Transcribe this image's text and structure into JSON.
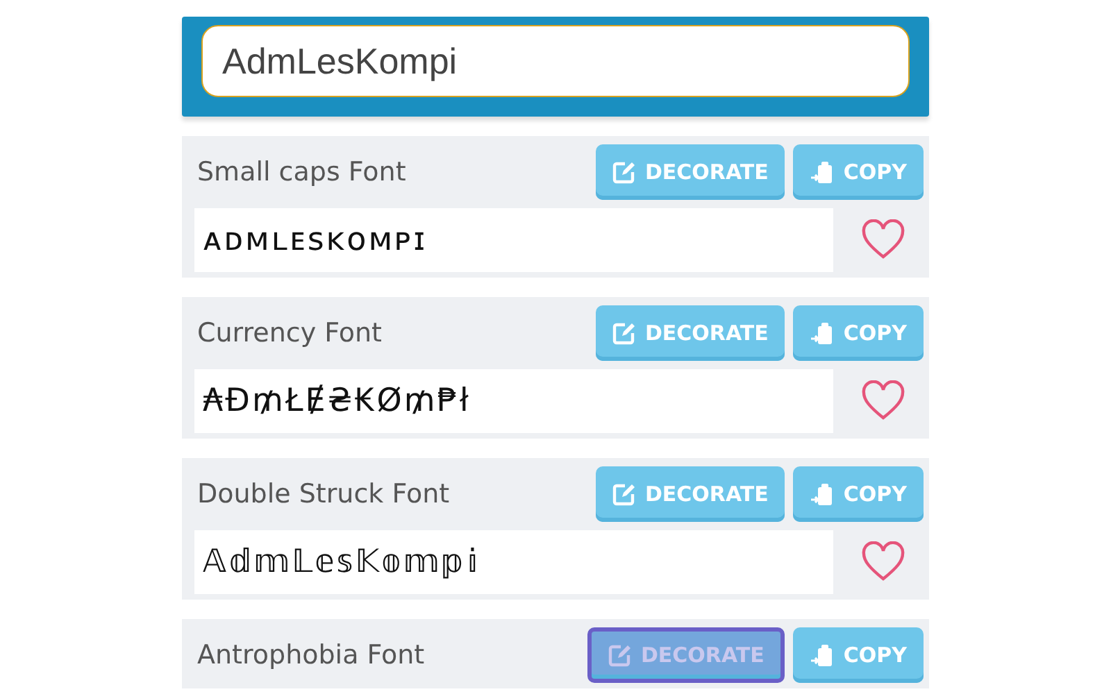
{
  "input": {
    "value": "AdmLesKompi"
  },
  "fonts": [
    {
      "name": "Small caps Font",
      "preview": "ᴀᴅᴍʟᴇꜱᴋᴏᴍᴘɪ",
      "decorate": "DECORATE",
      "copy": "COPY",
      "decorate_focused": false
    },
    {
      "name": "Currency Font",
      "preview": "₳Đ₥ŁɆ₴₭Ø₥₱ł",
      "decorate": "DECORATE",
      "copy": "COPY",
      "decorate_focused": false
    },
    {
      "name": "Double Struck Font",
      "preview": "𝔸𝕕𝕞𝕃𝕖𝕤𝕂𝕠𝕞𝕡𝕚",
      "decorate": "DECORATE",
      "copy": "COPY",
      "decorate_focused": false
    },
    {
      "name": "Antrophobia Font",
      "decorate": "DECORATE",
      "copy": "COPY",
      "decorate_focused": true
    }
  ]
}
